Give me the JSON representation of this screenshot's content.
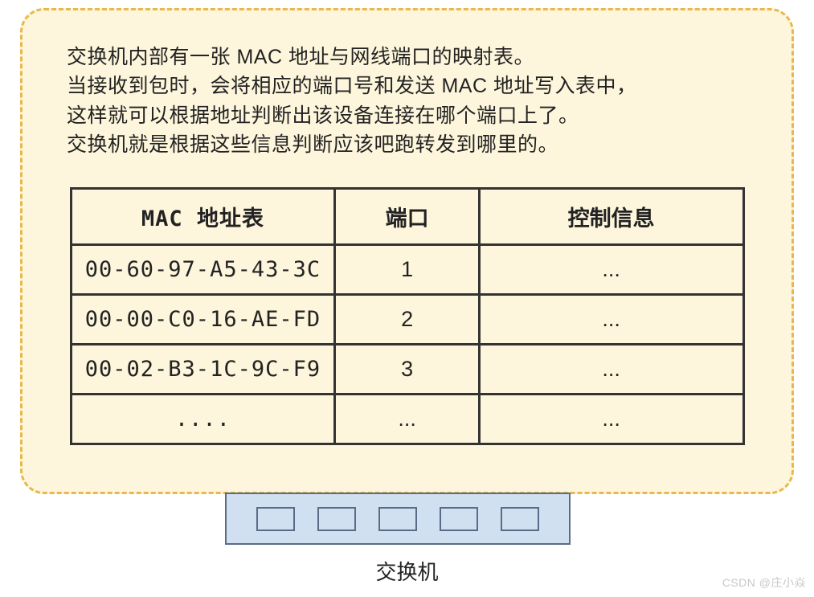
{
  "description": {
    "line1": "交换机内部有一张 MAC 地址与网线端口的映射表。",
    "line2": "当接收到包时，会将相应的端口号和发送 MAC 地址写入表中，",
    "line3": "这样就可以根据地址判断出该设备连接在哪个端口上了。",
    "line4": "交换机就是根据这些信息判断应该吧跑转发到哪里的。"
  },
  "table": {
    "headers": {
      "mac": "MAC 地址表",
      "port": "端口",
      "ctrl": "控制信息"
    },
    "rows": [
      {
        "mac": "00-60-97-A5-43-3C",
        "port": "1",
        "ctrl": "..."
      },
      {
        "mac": "00-00-C0-16-AE-FD",
        "port": "2",
        "ctrl": "..."
      },
      {
        "mac": "00-02-B3-1C-9C-F9",
        "port": "3",
        "ctrl": "..."
      },
      {
        "mac": "....",
        "port": "...",
        "ctrl": "..."
      }
    ]
  },
  "switch": {
    "label": "交换机",
    "port_count": 5
  },
  "watermark": "CSDN @庄小焱"
}
